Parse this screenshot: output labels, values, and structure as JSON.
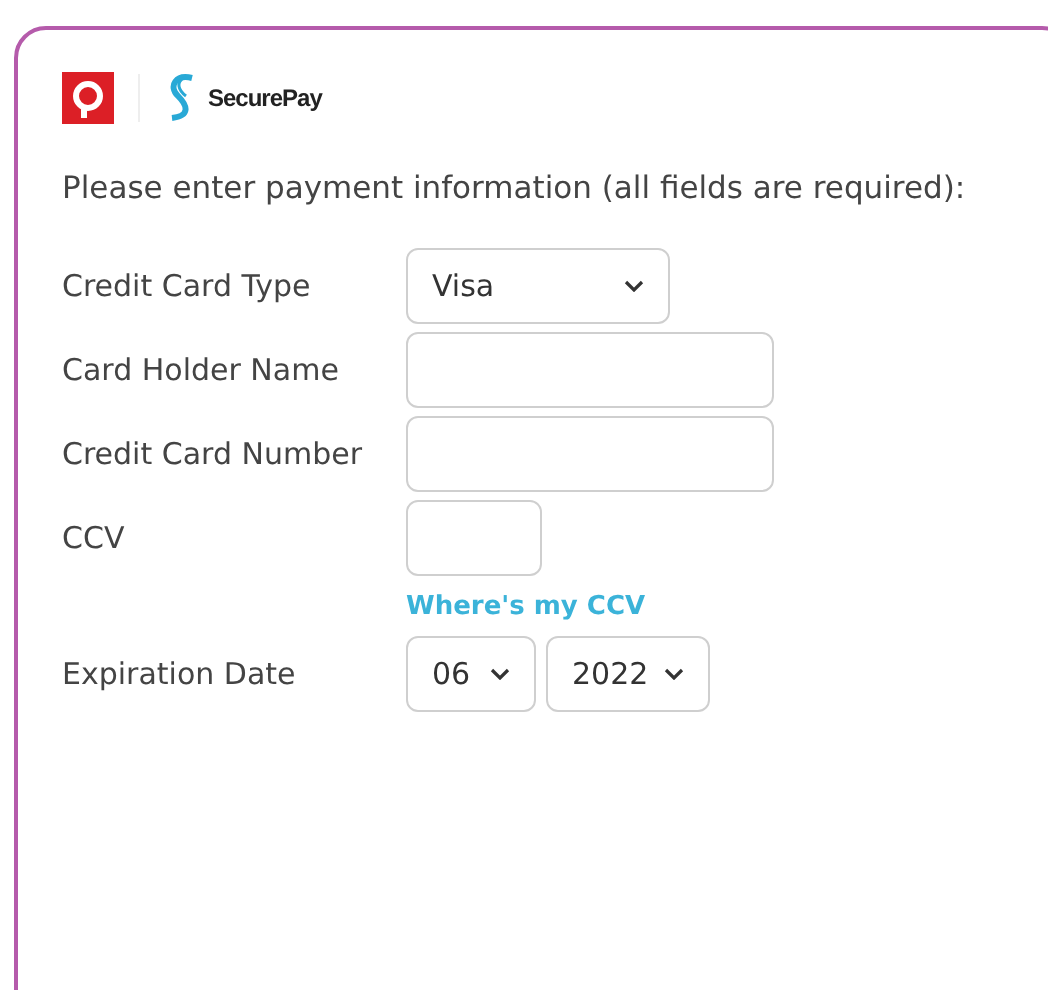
{
  "brand": {
    "name": "SecurePay"
  },
  "instructions": "Please enter payment information (all fields are required):",
  "fields": [
    {
      "kind": "select",
      "label": "Credit Card Type",
      "value": "Visa"
    },
    {
      "kind": "text",
      "label": "Card Holder Name"
    },
    {
      "kind": "text",
      "label": "Credit Card Number"
    },
    {
      "kind": "short_text",
      "label": "CCV",
      "link": "Where's my CCV"
    },
    {
      "kind": "date",
      "label": "Expiration Date",
      "selects": [
        "06",
        "2022"
      ]
    }
  ]
}
